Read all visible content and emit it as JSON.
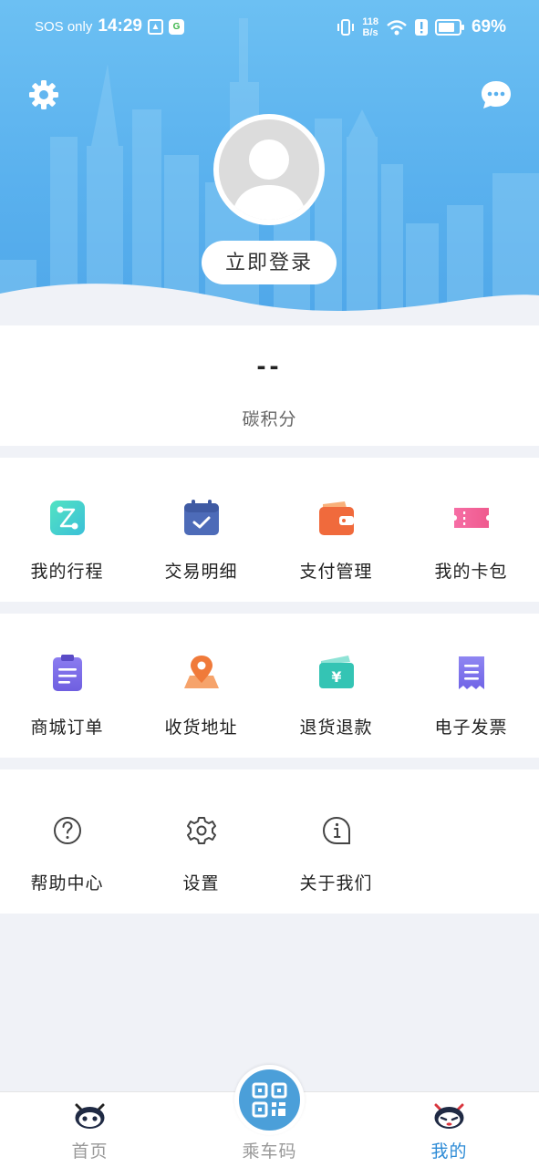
{
  "status_bar": {
    "carrier": "SOS only",
    "time": "14:29",
    "net_speed_value": "118",
    "net_speed_unit": "B/s",
    "battery": "69%"
  },
  "profile": {
    "settings_icon": "gear-icon",
    "message_icon": "chat-bubble-icon",
    "avatar_icon": "default-user-avatar",
    "login_label": "立即登录"
  },
  "carbon": {
    "value": "--",
    "label": "碳积分"
  },
  "grid1": [
    {
      "label": "我的行程",
      "icon": "trip-route-icon"
    },
    {
      "label": "交易明细",
      "icon": "calendar-check-icon"
    },
    {
      "label": "支付管理",
      "icon": "wallet-icon"
    },
    {
      "label": "我的卡包",
      "icon": "card-ticket-icon"
    }
  ],
  "grid2": [
    {
      "label": "商城订单",
      "icon": "clipboard-order-icon"
    },
    {
      "label": "收货地址",
      "icon": "map-pin-icon"
    },
    {
      "label": "退货退款",
      "icon": "refund-yen-icon"
    },
    {
      "label": "电子发票",
      "icon": "receipt-icon"
    }
  ],
  "grid3": [
    {
      "label": "帮助中心",
      "icon": "question-circle-icon"
    },
    {
      "label": "设置",
      "icon": "gear-icon"
    },
    {
      "label": "关于我们",
      "icon": "info-bubble-icon"
    }
  ],
  "bottom_nav": [
    {
      "label": "首页",
      "icon": "robot-mascot-icon",
      "active": false
    },
    {
      "label": "乘车码",
      "icon": "qr-code-icon",
      "active": false
    },
    {
      "label": "我的",
      "icon": "robot-mascot-icon",
      "active": true
    }
  ],
  "colors": {
    "header_blue": "#5ab1ee",
    "active_tab": "#2d8bd6",
    "qr_button": "#4b9fd9"
  }
}
